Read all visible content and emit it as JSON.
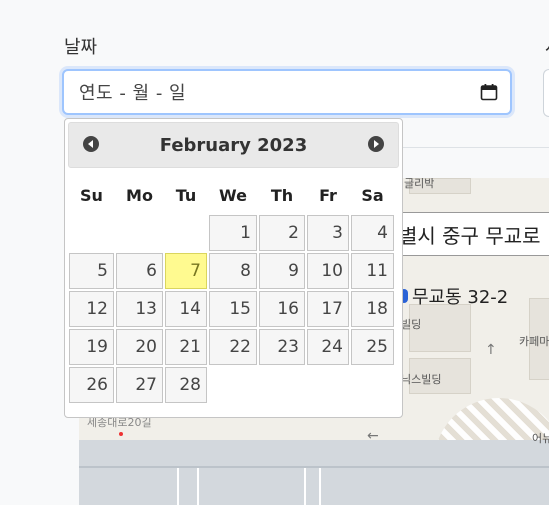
{
  "field": {
    "label": "날짜",
    "placeholder": "연도 - 월 - 일",
    "next_label": "사"
  },
  "map": {
    "labels": [
      "글리박",
      "빌딩",
      "닉스빌딩",
      "카페마",
      "어뉴",
      "세종대로20길"
    ],
    "address_text": "별시 중구 무교로",
    "address_line": "무교동 32-2"
  },
  "datepicker": {
    "title": "February 2023",
    "prev_label": "Prev",
    "next_label": "Next",
    "weekdays": [
      "Su",
      "Mo",
      "Tu",
      "We",
      "Th",
      "Fr",
      "Sa"
    ],
    "weeks": [
      [
        "",
        "",
        "",
        "1",
        "2",
        "3",
        "4"
      ],
      [
        "5",
        "6",
        "7",
        "8",
        "9",
        "10",
        "11"
      ],
      [
        "12",
        "13",
        "14",
        "15",
        "16",
        "17",
        "18"
      ],
      [
        "19",
        "20",
        "21",
        "22",
        "23",
        "24",
        "25"
      ],
      [
        "26",
        "27",
        "28",
        "",
        "",
        "",
        ""
      ]
    ],
    "highlighted_day": "7"
  },
  "colors": {
    "highlight": "#fffa90",
    "input_focus_border": "#9ec5fe"
  }
}
